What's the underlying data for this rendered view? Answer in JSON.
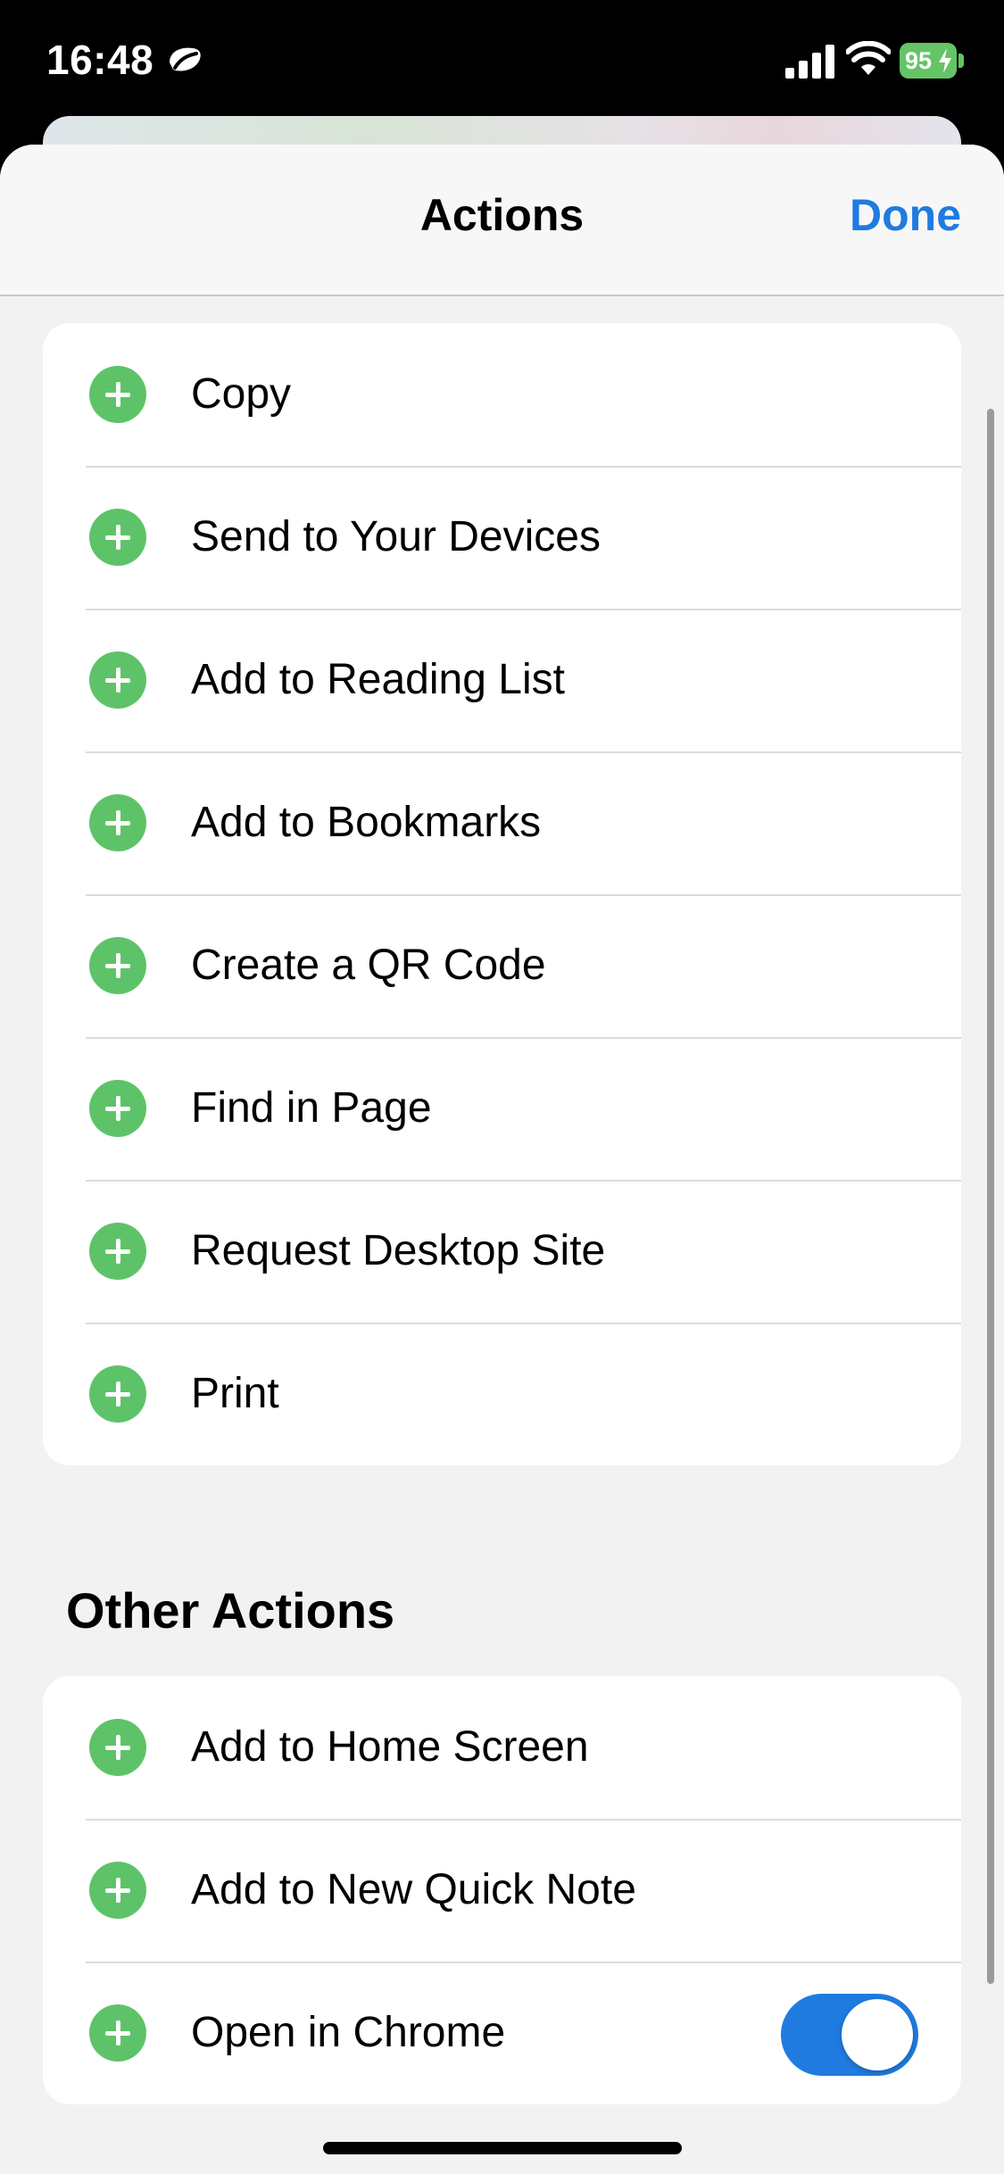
{
  "status_bar": {
    "time": "16:48",
    "battery": "95",
    "icons": [
      "focus-sleep-icon",
      "cellular-signal-icon",
      "wifi-icon",
      "battery-charging-icon"
    ]
  },
  "header": {
    "title": "Actions",
    "done_label": "Done"
  },
  "actions": {
    "items": [
      {
        "label": "Copy"
      },
      {
        "label": "Send to Your Devices"
      },
      {
        "label": "Add to Reading List"
      },
      {
        "label": "Add to Bookmarks"
      },
      {
        "label": "Create a QR Code"
      },
      {
        "label": "Find in Page"
      },
      {
        "label": "Request Desktop Site"
      },
      {
        "label": "Print"
      }
    ]
  },
  "other_actions": {
    "title": "Other Actions",
    "items": [
      {
        "label": "Add to Home Screen"
      },
      {
        "label": "Add to New Quick Note"
      },
      {
        "label": "Open in Chrome",
        "toggle": true
      }
    ]
  },
  "colors": {
    "accent": "#1f7be0",
    "add_green": "#5ec368",
    "battery_green": "#65c466",
    "background": "#f2f2f3"
  }
}
